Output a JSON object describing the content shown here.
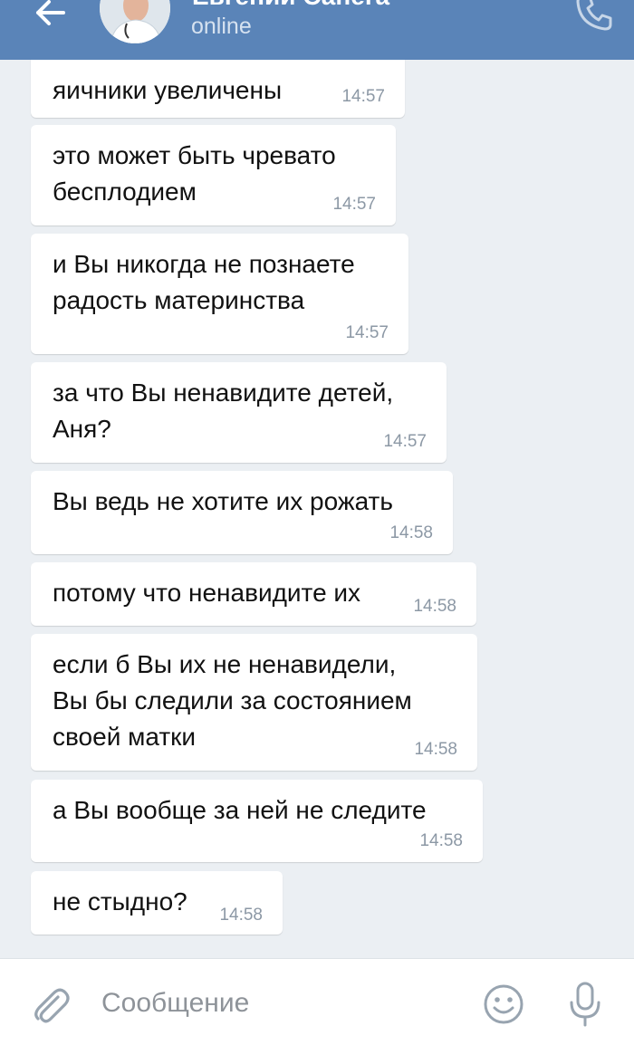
{
  "header": {
    "contact_name": "Евгений Санега",
    "status": "online"
  },
  "messages": [
    {
      "text": "яичники увеличены",
      "time": "14:57"
    },
    {
      "text": "это может быть чревато\nбесплодием",
      "time": "14:57"
    },
    {
      "text": "и Вы никогда не познаете\nрадость материнства",
      "time": "14:57"
    },
    {
      "text": "за что Вы ненавидите детей,\nАня?",
      "time": "14:57"
    },
    {
      "text": "Вы ведь не хотите их рожать",
      "time": "14:58"
    },
    {
      "text": "потому что ненавидите их",
      "time": "14:58"
    },
    {
      "text": "если б Вы их не ненавидели,\nВы бы следили за состоянием\nсвоей матки",
      "time": "14:58"
    },
    {
      "text": "а Вы вообще за ней не следите",
      "time": "14:58"
    },
    {
      "text": "не стыдно?",
      "time": "14:58"
    }
  ],
  "composer": {
    "placeholder": "Сообщение"
  },
  "icons": {
    "back": "arrow-left-icon",
    "call": "phone-icon",
    "attach": "paperclip-icon",
    "emoji": "smile-icon",
    "voice": "microphone-icon"
  },
  "colors": {
    "header": "#5a84b8",
    "background": "#ebeff3",
    "bubble": "#ffffff",
    "time": "#8c98a5"
  }
}
